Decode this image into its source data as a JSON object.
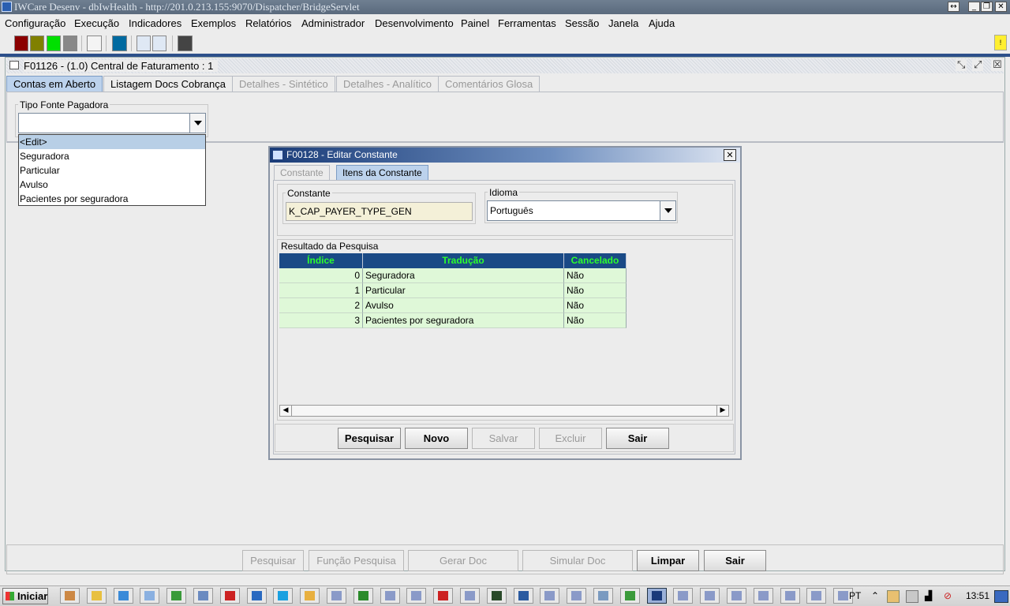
{
  "window": {
    "title": "IWCare Desenv - dbIwHealth - http://201.0.213.155:9070/Dispatcher/BridgeServlet",
    "controls": [
      "↔",
      "_",
      "❐",
      "✕"
    ]
  },
  "menu": [
    "Configuração",
    "Execução",
    "Indicadores",
    "Exemplos",
    "Relatórios",
    "Administrador",
    "Desenvolvimento",
    "Painel",
    "Ferramentas",
    "Sessão",
    "Janela",
    "Ajuda"
  ],
  "toolbar": {
    "swatches": [
      {
        "name": "dark-red-swatch",
        "color": "#8b0000"
      },
      {
        "name": "olive-swatch",
        "color": "#808000"
      },
      {
        "name": "green-swatch",
        "color": "#00e000"
      },
      {
        "name": "gray-swatch",
        "color": "#888888"
      },
      {
        "name": "white-swatch",
        "color": "#f4f4f4"
      },
      {
        "name": "teal-swatch",
        "color": "#006aa0"
      },
      {
        "name": "tree-view-icon",
        "color": "#dfe8f4"
      },
      {
        "name": "grid-view-icon",
        "color": "#dfe8f4"
      },
      {
        "name": "dark-gray-swatch",
        "color": "#444444"
      }
    ],
    "alert_badge": "!"
  },
  "frame": {
    "title": "F01126 - (1.0) Central de Faturamento : 1",
    "tabs": [
      "Contas em Aberto",
      "Listagem Docs Cobrança",
      "Detalhes - Sintético",
      "Detalhes - Analítico",
      "Comentários Glosa"
    ],
    "payer_group_label": "Tipo Fonte Pagadora",
    "payer_value": "",
    "dropdown_items": [
      "<Edit>",
      "Seguradora",
      "Particular",
      "Avulso",
      "Pacientes por seguradora"
    ],
    "buttons": [
      "Pesquisar",
      "Função Pesquisa",
      "Gerar Doc",
      "Simular Doc",
      "Limpar",
      "Sair"
    ]
  },
  "dialog": {
    "title": "F00128 - Editar Constante",
    "close": "✕",
    "tabs": [
      "Constante",
      "Itens da Constante"
    ],
    "constant_label": "Constante",
    "constant_value": "K_CAP_PAYER_TYPE_GEN",
    "language_label": "Idioma",
    "language_value": "Português",
    "results_label": "Resultado da Pesquisa",
    "columns": [
      "Índice",
      "Tradução",
      "Cancelado"
    ],
    "rows": [
      {
        "index": "0",
        "translation": "Seguradora",
        "cancelled": "Não"
      },
      {
        "index": "1",
        "translation": "Particular",
        "cancelled": "Não"
      },
      {
        "index": "2",
        "translation": "Avulso",
        "cancelled": "Não"
      },
      {
        "index": "3",
        "translation": "Pacientes por seguradora",
        "cancelled": "Não"
      }
    ],
    "buttons": [
      "Pesquisar",
      "Novo",
      "Salvar",
      "Excluir",
      "Sair"
    ]
  },
  "taskbar": {
    "start_label": "Iniciar",
    "language": "PT",
    "clock": "13:51",
    "apps": [
      {
        "name": "console-icon",
        "color": "#c84"
      },
      {
        "name": "folder-icon",
        "color": "#e8c040"
      },
      {
        "name": "ie-icon",
        "color": "#3a8ad8"
      },
      {
        "name": "notepad-icon",
        "color": "#8ab0e0"
      },
      {
        "name": "chrome-icon",
        "color": "#3a9a3a"
      },
      {
        "name": "document-icon",
        "color": "#6a8ac0"
      },
      {
        "name": "pdf-icon",
        "color": "#c22"
      },
      {
        "name": "vpn-icon",
        "color": "#2a6ac0"
      },
      {
        "name": "skype-icon",
        "color": "#1aa0e0"
      },
      {
        "name": "explorer-icon",
        "color": "#e8b040"
      },
      {
        "name": "java-icon",
        "color": "#8a9ac8"
      },
      {
        "name": "excel-icon",
        "color": "#2a8a2a"
      },
      {
        "name": "java-icon",
        "color": "#8a9ac8"
      },
      {
        "name": "java-icon",
        "color": "#8a9ac8"
      },
      {
        "name": "acrobat-icon",
        "color": "#c22"
      },
      {
        "name": "java-icon",
        "color": "#8a9ac8"
      },
      {
        "name": "terminal-icon",
        "color": "#2a4a2a"
      },
      {
        "name": "network-icon",
        "color": "#2a5aa0"
      },
      {
        "name": "java-icon",
        "color": "#8a9ac8"
      },
      {
        "name": "java-icon",
        "color": "#8a9ac8"
      },
      {
        "name": "window-icon",
        "color": "#7a9ac0"
      },
      {
        "name": "tree-icon",
        "color": "#3a9a3a"
      },
      {
        "name": "java-active-icon",
        "color": "#1a3a7a"
      },
      {
        "name": "java-icon",
        "color": "#8a9ac8"
      },
      {
        "name": "java-icon",
        "color": "#8a9ac8"
      },
      {
        "name": "java-icon",
        "color": "#8a9ac8"
      },
      {
        "name": "java-icon",
        "color": "#8a9ac8"
      },
      {
        "name": "java-icon",
        "color": "#8a9ac8"
      },
      {
        "name": "java-icon",
        "color": "#8a9ac8"
      },
      {
        "name": "java-icon",
        "color": "#8a9ac8"
      }
    ]
  }
}
